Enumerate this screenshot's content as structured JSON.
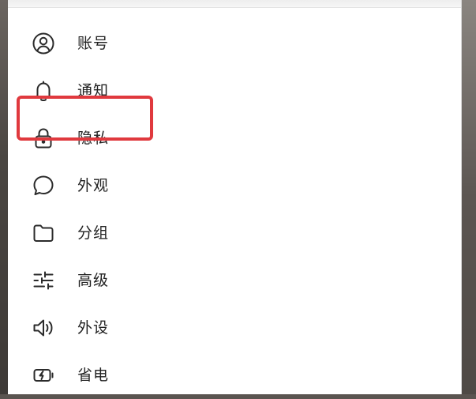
{
  "menu": {
    "items": [
      {
        "label": "账号",
        "icon": "account-circle-icon"
      },
      {
        "label": "通知",
        "icon": "bell-icon"
      },
      {
        "label": "隐私",
        "icon": "lock-icon"
      },
      {
        "label": "外观",
        "icon": "chat-bubble-icon"
      },
      {
        "label": "分组",
        "icon": "folder-icon"
      },
      {
        "label": "高级",
        "icon": "sliders-icon"
      },
      {
        "label": "外设",
        "icon": "speaker-icon"
      },
      {
        "label": "省电",
        "icon": "battery-charging-icon"
      }
    ],
    "highlighted_index": 2
  },
  "colors": {
    "highlight": "#e0393e",
    "text": "#222222",
    "icon": "#2b2b2b"
  }
}
